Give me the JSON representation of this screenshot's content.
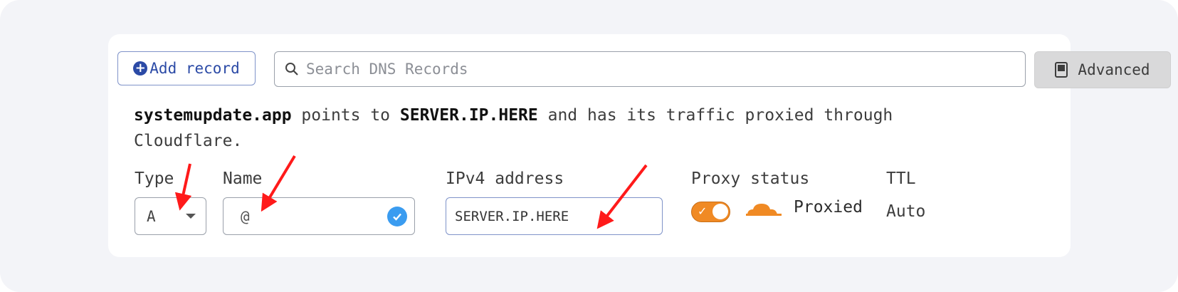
{
  "toolbar": {
    "add_record_label": "Add record",
    "search_placeholder": "Search DNS Records",
    "advanced_label": "Advanced"
  },
  "description": {
    "domain": "systemupdate.app",
    "text1": " points to ",
    "target": "SERVER.IP.HERE",
    "text2": " and has its traffic proxied through",
    "text3": "Cloudflare."
  },
  "form": {
    "type_label": "Type",
    "type_value": "A",
    "name_label": "Name",
    "name_value": "@",
    "ipv4_label": "IPv4 address",
    "ipv4_value": "SERVER.IP.HERE",
    "proxy_label": "Proxy status",
    "proxy_value": "Proxied",
    "proxy_enabled": true,
    "ttl_label": "TTL",
    "ttl_value": "Auto"
  },
  "colors": {
    "accent_blue": "#2b4aa6",
    "toggle_orange": "#f08a24",
    "annotation_red": "#ff1a1a"
  },
  "icons": [
    "plus-circle-icon",
    "search-icon",
    "book-icon",
    "chevron-down-icon",
    "check-circle-icon",
    "cloud-icon"
  ]
}
